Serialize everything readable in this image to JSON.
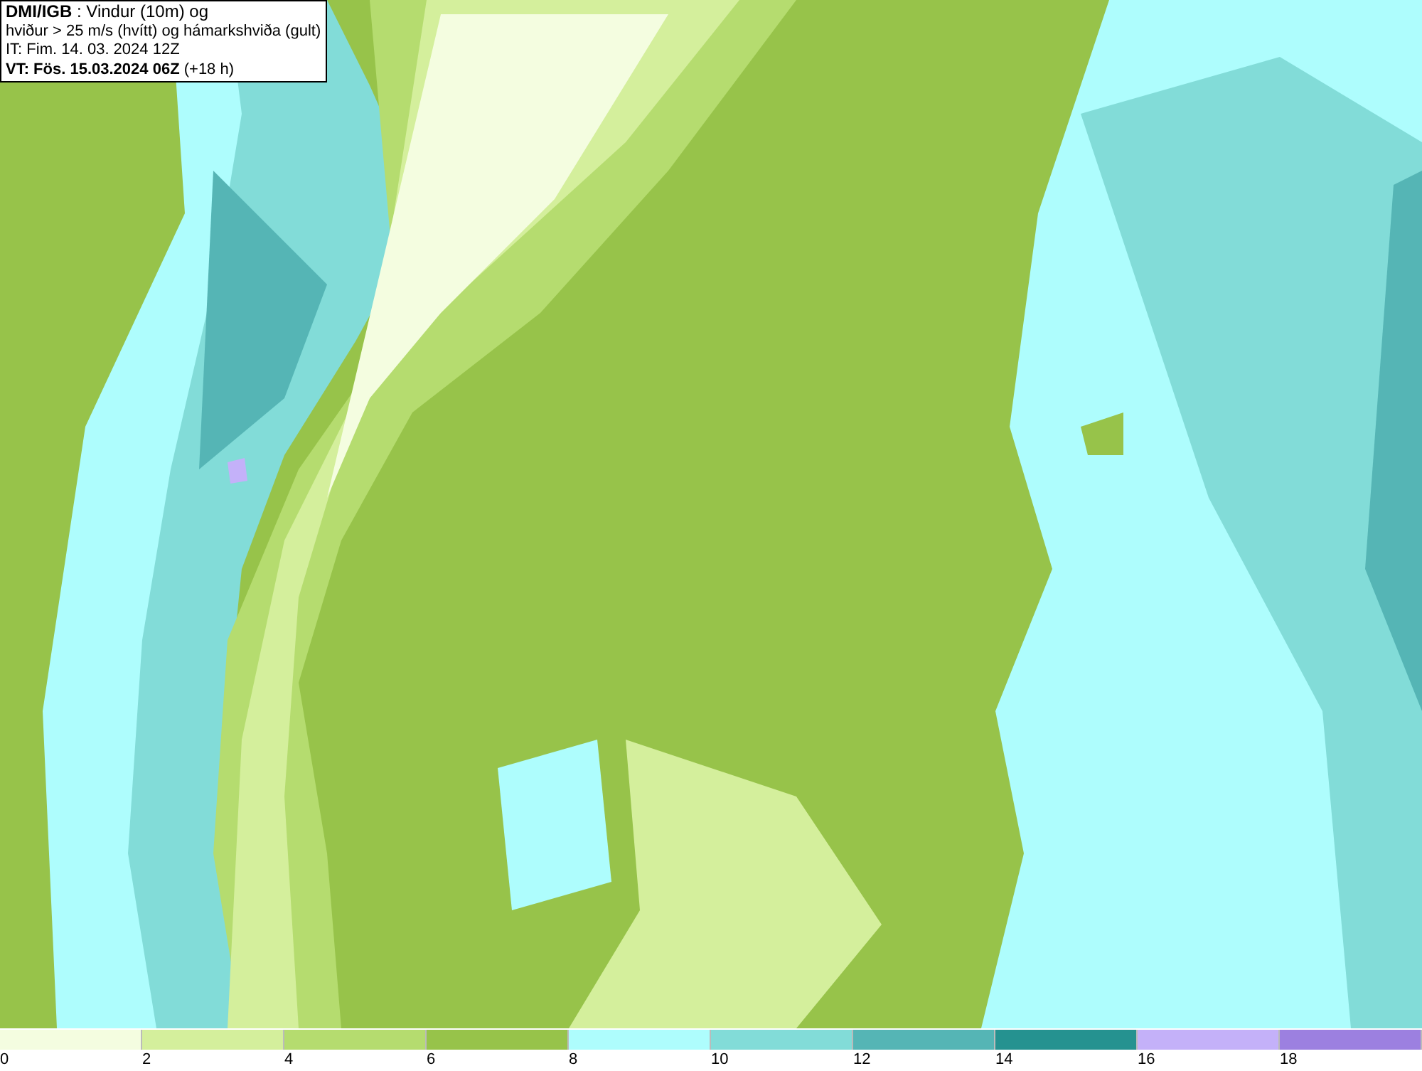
{
  "map": {
    "info_box": {
      "lines": [
        "**DMI/IGB** : Vindur (10m) og",
        "hviður > 25 m/s (hvítt) og hámarkshviða (gult)",
        "IT: Fim. 14. 03. 2024 12Z",
        "**VT: Fös. 15.03.2024 06Z** (+18 h)"
      ]
    }
  },
  "legend": {
    "bins": [
      {
        "label": "0",
        "color": "#f4fde0"
      },
      {
        "label": "2",
        "color": "#d4ef9c"
      },
      {
        "label": "4",
        "color": "#b5dc6f"
      },
      {
        "label": "6",
        "color": "#97c34a"
      },
      {
        "label": "8",
        "color": "#aefdfd"
      },
      {
        "label": "10",
        "color": "#82dcd8"
      },
      {
        "label": "12",
        "color": "#55b5b5"
      },
      {
        "label": "14",
        "color": "#259290"
      },
      {
        "label": "16",
        "color": "#c4b1f9"
      },
      {
        "label": "18",
        "color": "#9c80e0"
      }
    ]
  }
}
